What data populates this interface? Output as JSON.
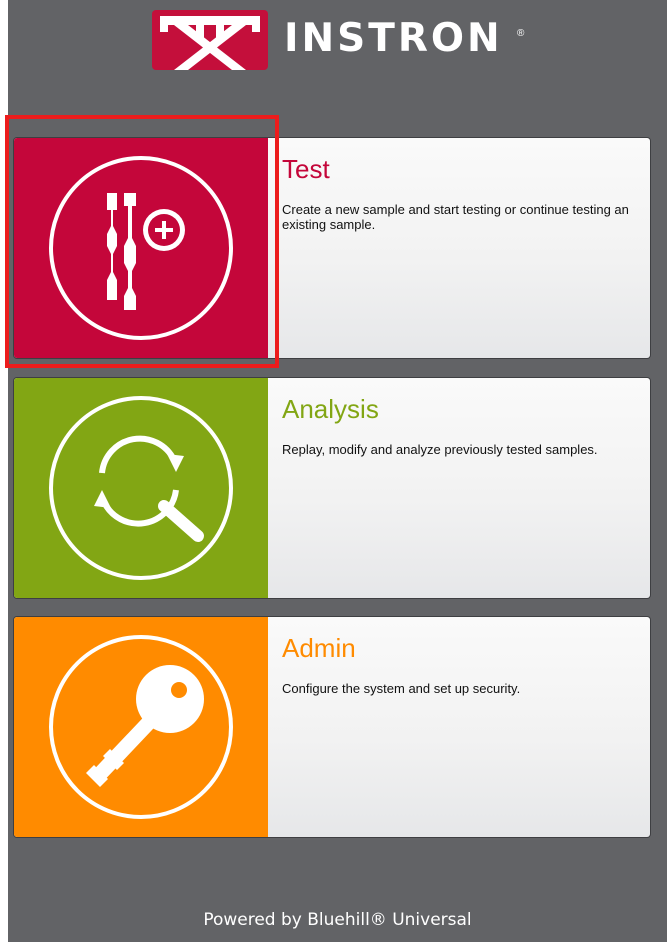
{
  "brand": {
    "name": "INSTRON",
    "registered_mark": "®",
    "logo_icon": "instron-frame-logo-icon",
    "colors": {
      "background": "#626366",
      "logo_red": "#c40f3b"
    }
  },
  "cards": [
    {
      "id": "test",
      "title": "Test",
      "description": "Create a new sample and start testing or continue testing an existing sample.",
      "icon": "test-specimen-add-icon",
      "color": "#c4063a",
      "selected": true
    },
    {
      "id": "analysis",
      "title": "Analysis",
      "description": "Replay, modify and analyze previously tested samples.",
      "icon": "magnifier-refresh-icon",
      "color": "#82a614"
    },
    {
      "id": "admin",
      "title": "Admin",
      "description": "Configure the system and set up security.",
      "icon": "key-icon",
      "color": "#ff8b00"
    }
  ],
  "footer": {
    "text": "Powered by Bluehill® Universal"
  }
}
